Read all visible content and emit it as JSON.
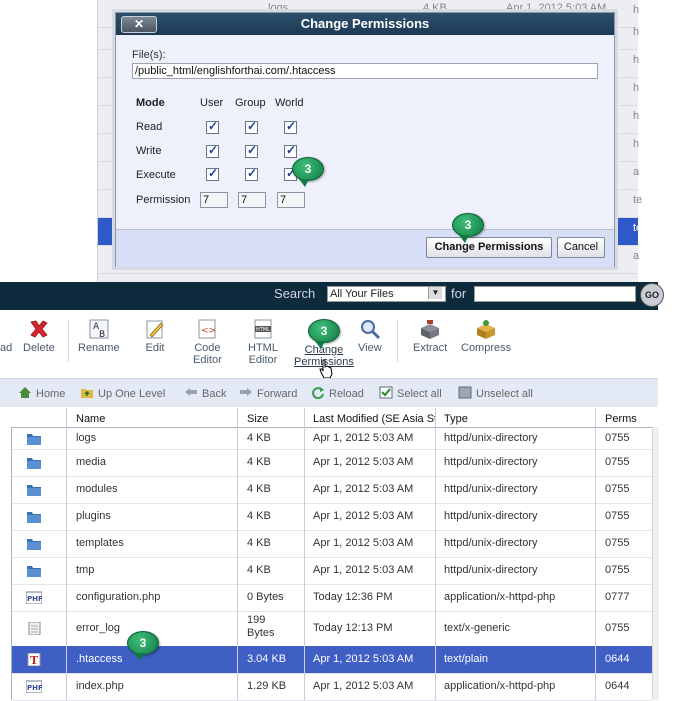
{
  "dialog": {
    "title": "Change Permissions",
    "close_label": "✕",
    "files_label": "File(s):",
    "files_value": "/public_html/englishforthai.com/.htaccess",
    "mode_label": "Mode",
    "col_user": "User",
    "col_group": "Group",
    "col_world": "World",
    "row_read": "Read",
    "row_write": "Write",
    "row_execute": "Execute",
    "row_permission": "Permission",
    "perm_user": "7",
    "perm_group": "7",
    "perm_world": "7",
    "change_button": "Change Permissions",
    "cancel_button": "Cancel"
  },
  "background_list": [
    {
      "name": "logs",
      "size": "4 KB",
      "date": "Apr 1, 2012 5:03 AM",
      "tail": "h"
    },
    {
      "name": "",
      "size": "",
      "date": "",
      "tail": "h"
    },
    {
      "name": "",
      "size": "",
      "date": "",
      "tail": "h"
    },
    {
      "name": "",
      "size": "",
      "date": "",
      "tail": "h"
    },
    {
      "name": "",
      "size": "",
      "date": "",
      "tail": "h"
    },
    {
      "name": "",
      "size": "",
      "date": "",
      "tail": "h"
    },
    {
      "name": "",
      "size": "",
      "date": "",
      "tail": "a"
    },
    {
      "name": "",
      "size": "",
      "date": "",
      "tail": "te"
    },
    {
      "name": "",
      "size": "",
      "date": "",
      "tail": "te"
    },
    {
      "name": "",
      "size": "",
      "date": "",
      "tail": "a"
    }
  ],
  "callout": "3",
  "search": {
    "label": "Search",
    "selected": "All Your Files",
    "for_label": "for",
    "go_label": "GO"
  },
  "toolbar": {
    "download": "ad",
    "delete": "Delete",
    "rename": "Rename",
    "edit": "Edit",
    "code_editor_1": "Code",
    "code_editor_2": "Editor",
    "html_editor_1": "HTML",
    "html_editor_2": "Editor",
    "change_perm_1": "Change",
    "change_perm_2": "Permissions",
    "view": "View",
    "extract": "Extract",
    "compress": "Compress"
  },
  "nav": {
    "home": "Home",
    "up_one_level": "Up One Level",
    "back": "Back",
    "forward": "Forward",
    "reload": "Reload",
    "select_all": "Select all",
    "unselect_all": "Unselect all"
  },
  "table": {
    "headers": {
      "name": "Name",
      "size": "Size",
      "modified": "Last Modified (SE Asia St",
      "type": "Type",
      "perms": "Perms"
    },
    "rows": [
      {
        "icon": "folder-icon",
        "name": "logs",
        "size": "4 KB",
        "modified": "Apr 1, 2012 5:03 AM",
        "type": "httpd/unix-directory",
        "perms": "0755"
      },
      {
        "icon": "folder-icon",
        "name": "media",
        "size": "4 KB",
        "modified": "Apr 1, 2012 5:03 AM",
        "type": "httpd/unix-directory",
        "perms": "0755"
      },
      {
        "icon": "folder-icon",
        "name": "modules",
        "size": "4 KB",
        "modified": "Apr 1, 2012 5:03 AM",
        "type": "httpd/unix-directory",
        "perms": "0755"
      },
      {
        "icon": "folder-icon",
        "name": "plugins",
        "size": "4 KB",
        "modified": "Apr 1, 2012 5:03 AM",
        "type": "httpd/unix-directory",
        "perms": "0755"
      },
      {
        "icon": "folder-icon",
        "name": "templates",
        "size": "4 KB",
        "modified": "Apr 1, 2012 5:03 AM",
        "type": "httpd/unix-directory",
        "perms": "0755"
      },
      {
        "icon": "folder-icon",
        "name": "tmp",
        "size": "4 KB",
        "modified": "Apr 1, 2012 5:03 AM",
        "type": "httpd/unix-directory",
        "perms": "0755"
      },
      {
        "icon": "php-icon",
        "name": "configuration.php",
        "size": "0 Bytes",
        "modified": "Today 12:36 PM",
        "type": "application/x-httpd-php",
        "perms": "0777"
      },
      {
        "icon": "text-file-icon",
        "name": "error_log",
        "size": "199 Bytes",
        "modified": "Today 12:13 PM",
        "type": "text/x-generic",
        "perms": "0755"
      },
      {
        "icon": "text-plain-icon",
        "name": ".htaccess",
        "size": "3.04 KB",
        "modified": "Apr 1, 2012 5:03 AM",
        "type": "text/plain",
        "perms": "0644"
      },
      {
        "icon": "php-icon",
        "name": "index.php",
        "size": "1.29 KB",
        "modified": "Apr 1, 2012 5:03 AM",
        "type": "application/x-httpd-php",
        "perms": "0644"
      }
    ]
  },
  "colors": {
    "dialog_title": "#1d3a54",
    "selected_row": "#3f5fc4",
    "callout": "#0f7a43",
    "search_bar": "#0e2b3d"
  }
}
